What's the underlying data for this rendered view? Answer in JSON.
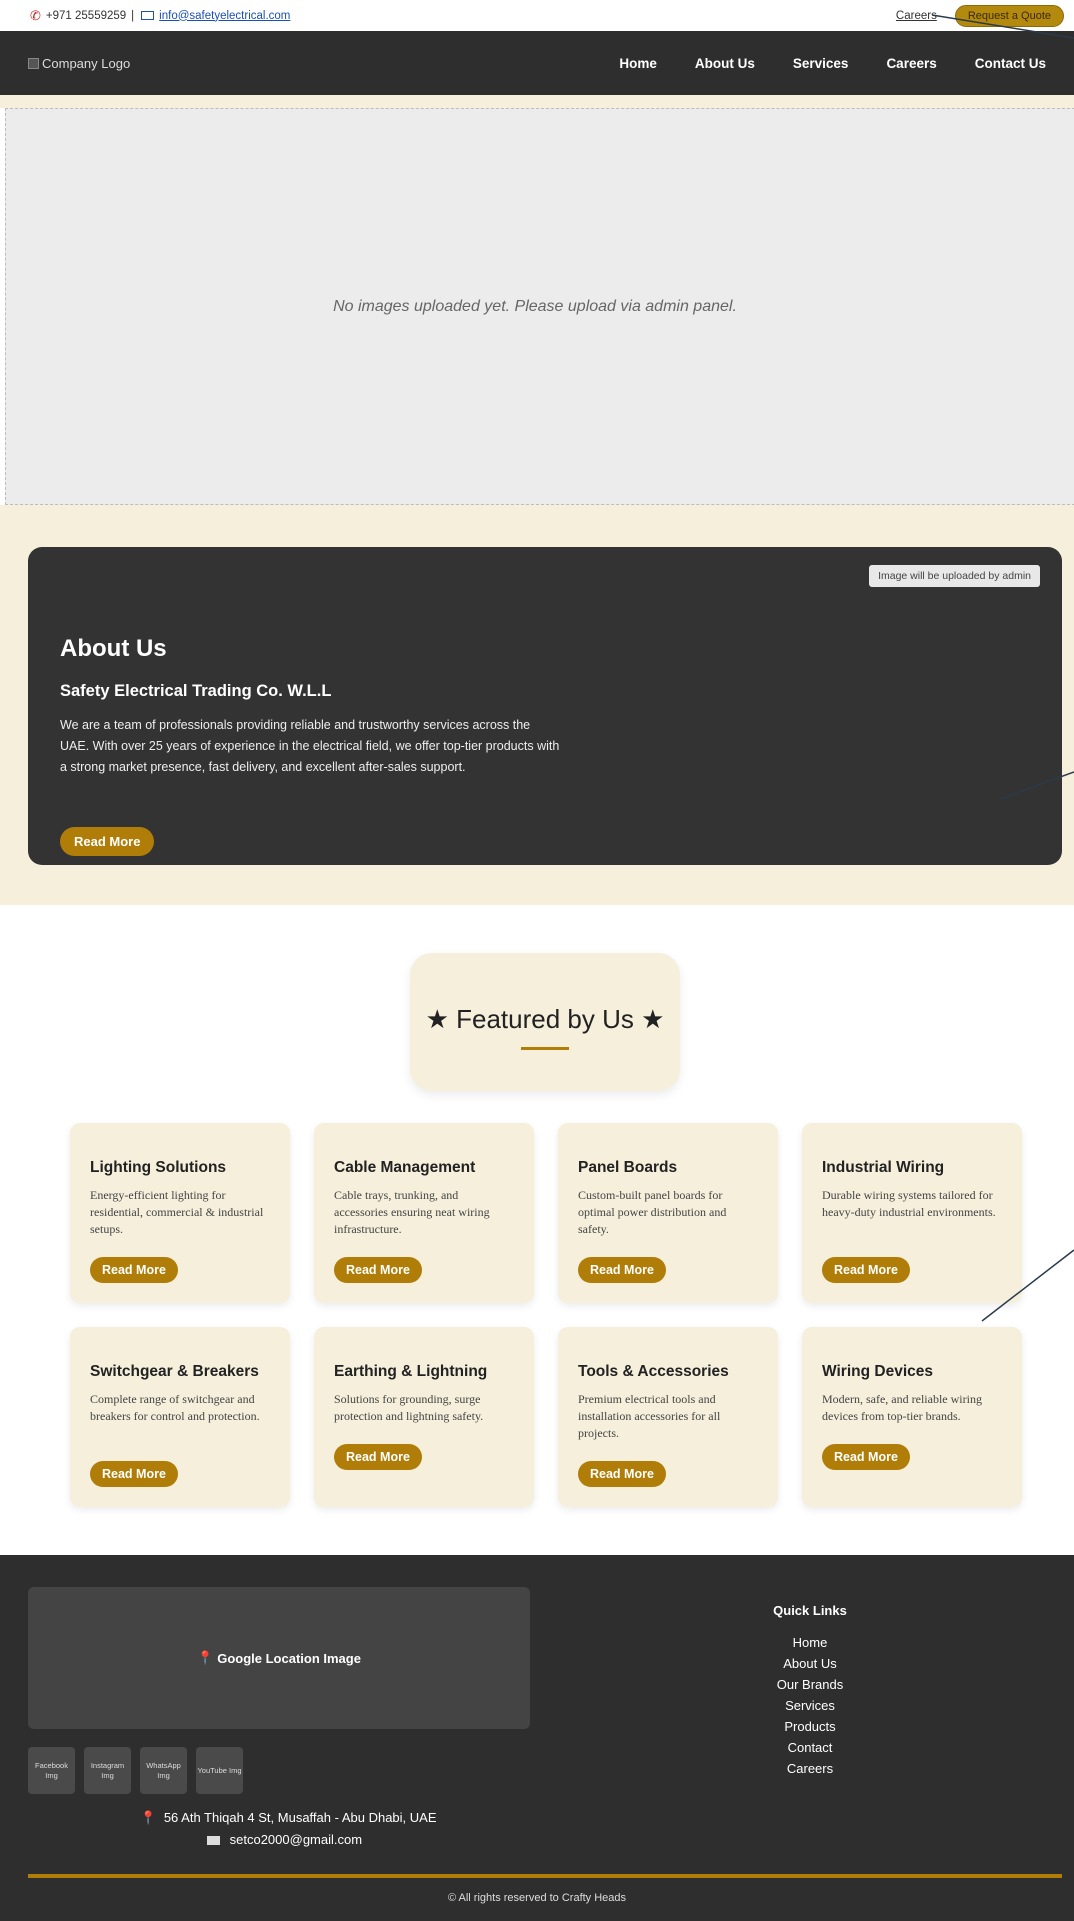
{
  "topbar": {
    "phone": "+971 25559259",
    "separator": "|",
    "email": "info@safetyelectrical.com",
    "careers_link": "Careers",
    "quote_button": "Request a Quote"
  },
  "navbar": {
    "logo_alt": "Company Logo",
    "links": [
      "Home",
      "About Us",
      "Services",
      "Careers",
      "Contact Us"
    ]
  },
  "hero": {
    "message": "No images uploaded yet. Please upload via admin panel."
  },
  "about": {
    "image_note": "Image will be uploaded by admin",
    "title": "About Us",
    "company": "Safety Electrical Trading Co. W.L.L",
    "description": "We are a team of professionals providing reliable and trustworthy services across the UAE. With over 25 years of experience in the electrical field, we offer top-tier products with a strong market presence, fast delivery, and excellent after-sales support.",
    "button": "Read More"
  },
  "featured": {
    "title": "★ Featured by Us ★",
    "cards": [
      {
        "title": "Lighting Solutions",
        "text": "Energy-efficient lighting for residential, commercial & industrial setups.",
        "button": "Read More"
      },
      {
        "title": "Cable Management",
        "text": "Cable trays, trunking, and accessories ensuring neat wiring infrastructure.",
        "button": "Read More"
      },
      {
        "title": "Panel Boards",
        "text": "Custom-built panel boards for optimal power distribution and safety.",
        "button": "Read More"
      },
      {
        "title": "Industrial Wiring",
        "text": "Durable wiring systems tailored for heavy-duty industrial environments.",
        "button": "Read More"
      },
      {
        "title": "Switchgear & Breakers",
        "text": "Complete range of switchgear and breakers for control and protection.",
        "button": "Read More"
      },
      {
        "title": "Earthing & Lightning",
        "text": "Solutions for grounding, surge protection and lightning safety.",
        "button": "Read More"
      },
      {
        "title": "Tools & Accessories",
        "text": "Premium electrical tools and installation accessories for all projects.",
        "button": "Read More"
      },
      {
        "title": "Wiring Devices",
        "text": "Modern, safe, and reliable wiring devices from top-tier brands.",
        "button": "Read More"
      }
    ]
  },
  "footer": {
    "map_label": "Google Location Image",
    "social": [
      "Facebook Img",
      "Instagram Img",
      "WhatsApp Img",
      "YouTube Img"
    ],
    "address": "56 Ath Thiqah 4 St, Musaffah - Abu Dhabi, UAE",
    "email": "setco2000@gmail.com",
    "quick_links_title": "Quick Links",
    "quick_links": [
      "Home",
      "About Us",
      "Our Brands",
      "Services",
      "Products",
      "Contact",
      "Careers"
    ],
    "copyright": "© All rights reserved to Crafty Heads"
  },
  "colors": {
    "accent_gold": "#b07d08",
    "cream": "#f5efdc",
    "dark": "#2e2e2e"
  }
}
